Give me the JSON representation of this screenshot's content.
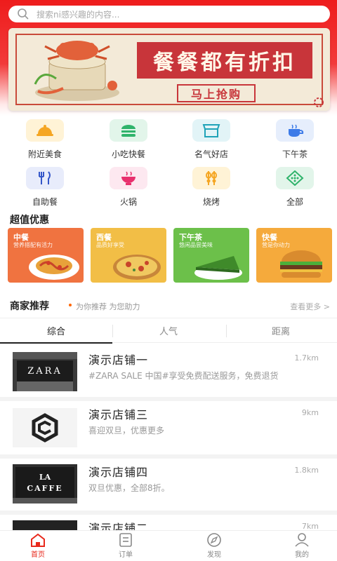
{
  "search": {
    "placeholder": "搜索ni感兴趣的内容..."
  },
  "banner": {
    "headline": "餐餐都有折扣",
    "cta": "马上抢购"
  },
  "categories": [
    {
      "label": "附近美食",
      "icon": "cloche-icon",
      "bg": "#fff3d6"
    },
    {
      "label": "小吃快餐",
      "icon": "burger-icon",
      "bg": "#e2f5ea"
    },
    {
      "label": "名气好店",
      "icon": "storefront-icon",
      "bg": "#e2f4f7"
    },
    {
      "label": "下午茶",
      "icon": "teapot-icon",
      "bg": "#e6eefc"
    },
    {
      "label": "自助餐",
      "icon": "cutlery-icon",
      "bg": "#e8ecfb"
    },
    {
      "label": "火锅",
      "icon": "hotpot-icon",
      "bg": "#fde8f0"
    },
    {
      "label": "烧烤",
      "icon": "skewer-icon",
      "bg": "#fff3d6"
    },
    {
      "label": "全部",
      "icon": "grid-icon",
      "bg": "#e2f5ea"
    }
  ],
  "deals_section": {
    "title": "超值优惠"
  },
  "deals": [
    {
      "title": "中餐",
      "sub": "营养搭配有活力",
      "color": "#f07340"
    },
    {
      "title": "西餐",
      "sub": "品质好享受",
      "color": "#f2be46"
    },
    {
      "title": "下午茶",
      "sub": "悠闲品尝美味",
      "color": "#6cc04a"
    },
    {
      "title": "快餐",
      "sub": "营是你动力",
      "color": "#f5aa3c"
    }
  ],
  "merchants": {
    "title": "商家推荐",
    "subtitle": "为你推荐 为您助力",
    "see_more": "查看更多 >"
  },
  "tabs": [
    "综合",
    "人气",
    "距离"
  ],
  "stores": [
    {
      "name": "演示店铺一",
      "distance": "1.7km",
      "desc": "#ZARA SALE 中国#享受免费配送服务，免费退货"
    },
    {
      "name": "演示店铺三",
      "distance": "9km",
      "desc": "喜迎双旦，优惠更多"
    },
    {
      "name": "演示店铺四",
      "distance": "1.8km",
      "desc": "双旦优惠，全部8折。"
    },
    {
      "name": "演示店铺二",
      "distance": "7km",
      "desc": ""
    }
  ],
  "store_thumb_text": {
    "zara": "ZARA",
    "cafe_line1": "LA",
    "cafe_line2": "CAFFE"
  },
  "bottom_nav": [
    {
      "label": "首页",
      "icon": "home-icon"
    },
    {
      "label": "订单",
      "icon": "order-icon"
    },
    {
      "label": "发现",
      "icon": "compass-icon"
    },
    {
      "label": "我的",
      "icon": "user-icon"
    }
  ],
  "colors": {
    "brand_red": "#e8291c"
  }
}
